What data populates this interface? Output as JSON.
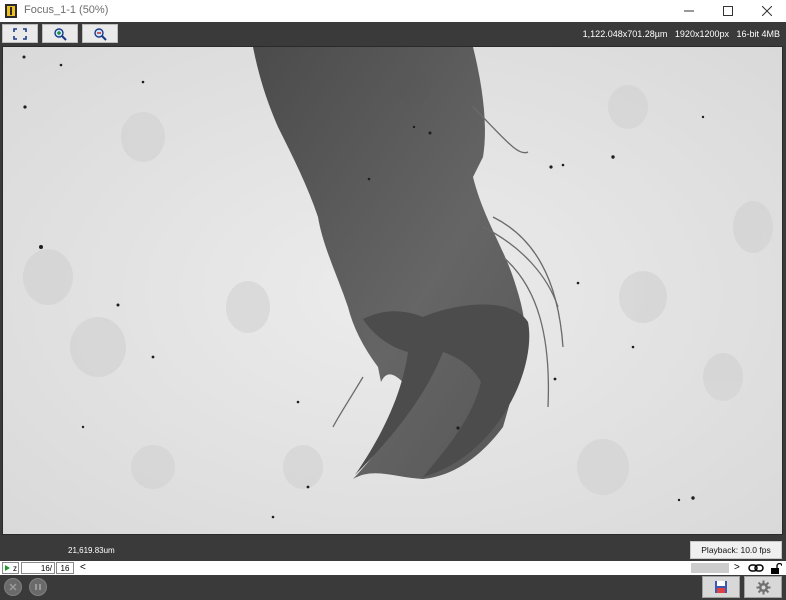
{
  "window": {
    "title": "Focus_1-1 (50%)"
  },
  "toolbar": {
    "info": "1,122.048x701.28µm   1920x1200px   16-bit 4MB"
  },
  "status": {
    "scale_bar": "21,619.83um",
    "playback": "Playback: 10.0 fps"
  },
  "zbar": {
    "z_label": "z",
    "current": "16/",
    "total": "16",
    "arrow_left": "<",
    "arrow_right": ">"
  },
  "icons": [
    "app-icon",
    "minimize-icon",
    "maximize-icon",
    "close-icon",
    "fit-to-window-icon",
    "zoom-in-icon",
    "zoom-out-icon",
    "play-icon",
    "link-icon",
    "unlock-icon",
    "close-circle-icon",
    "pause-icon",
    "save-icon",
    "settings-icon"
  ],
  "colors": {
    "chrome": "#3a3a3a",
    "image_bg": "#e6e6e6",
    "specimen": "#565656"
  }
}
